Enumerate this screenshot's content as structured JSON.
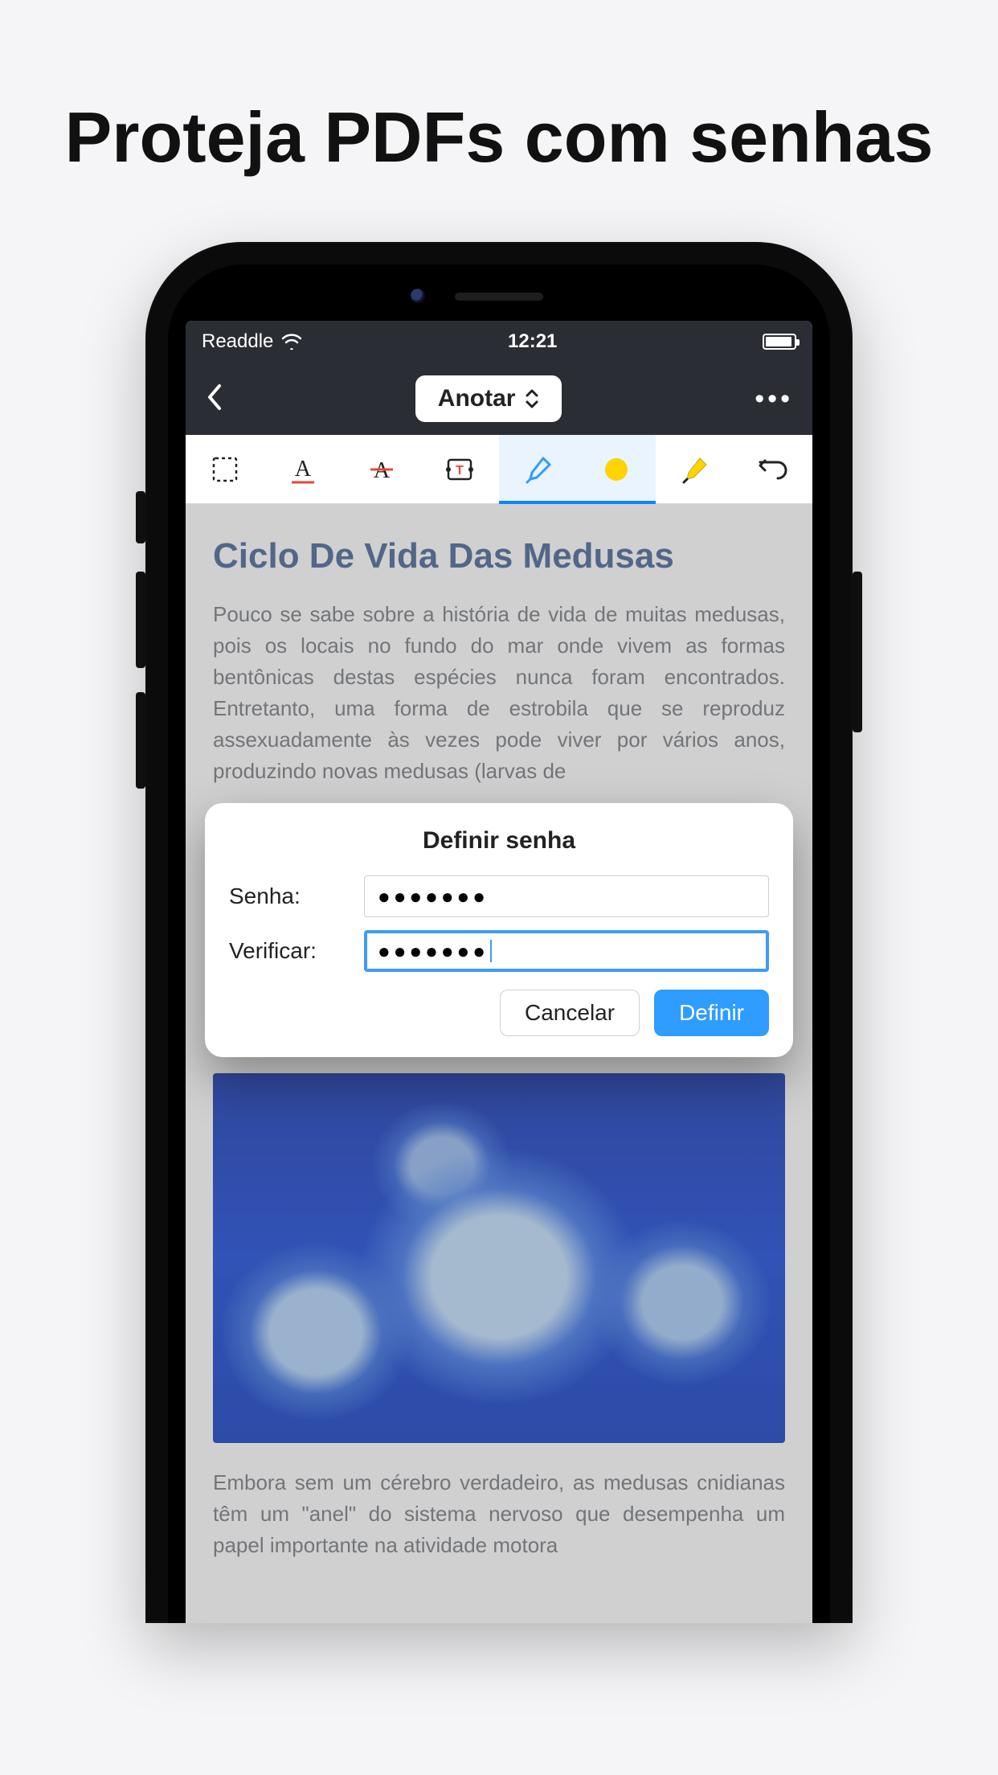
{
  "marketing": {
    "title": "Proteja PDFs com senhas"
  },
  "status": {
    "carrier": "Readdle",
    "time": "12:21"
  },
  "nav": {
    "mode_label": "Anotar"
  },
  "document": {
    "title": "Ciclo De Vida Das Medusas",
    "para1": "Pouco se sabe sobre a história de vida de muitas medusas, pois os locais no fundo do mar onde vivem as formas bentônicas destas espécies nunca foram encontrados. Entretanto, uma forma de estrobila que se reproduz assexuadamente às vezes pode viver por vários anos, produzindo novas medusas (larvas de",
    "para2": "Embora sem um cérebro verdadeiro, as medusas cnidianas têm um \"anel\" do sistema nervoso que desempenha um papel importante na atividade motora"
  },
  "modal": {
    "title": "Definir senha",
    "password_label": "Senha:",
    "verify_label": "Verificar:",
    "password_value": "●●●●●●●",
    "verify_value": "●●●●●●●",
    "cancel": "Cancelar",
    "confirm": "Definir"
  },
  "tools": {
    "select": "select-box",
    "underline": "text-underline",
    "strike": "text-strikethrough",
    "textbox": "text-box",
    "highlighter": "highlighter",
    "color": "color",
    "marker": "marker",
    "undo": "undo"
  },
  "colors": {
    "accent": "#2f9cff",
    "tool_yellow": "#ffd400"
  }
}
